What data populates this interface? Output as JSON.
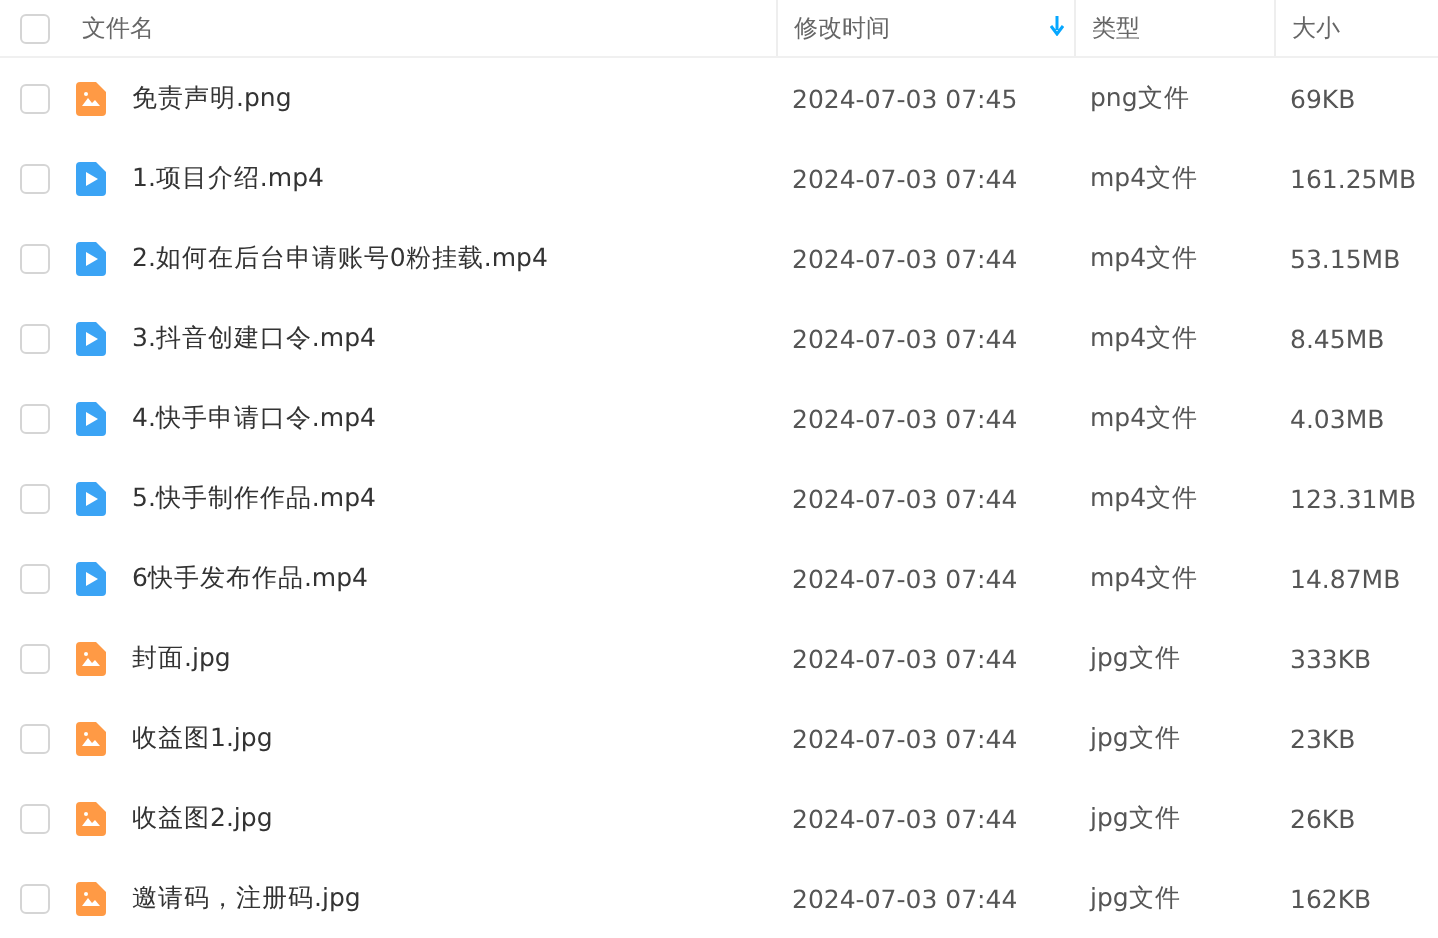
{
  "header": {
    "select_all": {
      "checked": false
    },
    "columns": [
      {
        "label": "文件名",
        "sorted": false
      },
      {
        "label": "修改时间",
        "sorted": true
      },
      {
        "label": "类型",
        "sorted": false
      },
      {
        "label": "大小",
        "sorted": false
      }
    ]
  },
  "files": [
    {
      "kind": "image",
      "name": "免责声明.png",
      "modified": "2024-07-03 07:45",
      "type": "png文件",
      "size": "69KB",
      "checked": false
    },
    {
      "kind": "video",
      "name": "1.项目介绍.mp4",
      "modified": "2024-07-03 07:44",
      "type": "mp4文件",
      "size": "161.25MB",
      "checked": false
    },
    {
      "kind": "video",
      "name": "2.如何在后台申请账号0粉挂载.mp4",
      "modified": "2024-07-03 07:44",
      "type": "mp4文件",
      "size": "53.15MB",
      "checked": false
    },
    {
      "kind": "video",
      "name": "3.抖音创建口令.mp4",
      "modified": "2024-07-03 07:44",
      "type": "mp4文件",
      "size": "8.45MB",
      "checked": false
    },
    {
      "kind": "video",
      "name": "4.快手申请口令.mp4",
      "modified": "2024-07-03 07:44",
      "type": "mp4文件",
      "size": "4.03MB",
      "checked": false
    },
    {
      "kind": "video",
      "name": "5.快手制作作品.mp4",
      "modified": "2024-07-03 07:44",
      "type": "mp4文件",
      "size": "123.31MB",
      "checked": false
    },
    {
      "kind": "video",
      "name": "6快手发布作品.mp4",
      "modified": "2024-07-03 07:44",
      "type": "mp4文件",
      "size": "14.87MB",
      "checked": false
    },
    {
      "kind": "image",
      "name": "封面.jpg",
      "modified": "2024-07-03 07:44",
      "type": "jpg文件",
      "size": "333KB",
      "checked": false
    },
    {
      "kind": "image",
      "name": "收益图1.jpg",
      "modified": "2024-07-03 07:44",
      "type": "jpg文件",
      "size": "23KB",
      "checked": false
    },
    {
      "kind": "image",
      "name": "收益图2.jpg",
      "modified": "2024-07-03 07:44",
      "type": "jpg文件",
      "size": "26KB",
      "checked": false
    },
    {
      "kind": "image",
      "name": "邀请码，注册码.jpg",
      "modified": "2024-07-03 07:44",
      "type": "jpg文件",
      "size": "162KB",
      "checked": false
    }
  ]
}
